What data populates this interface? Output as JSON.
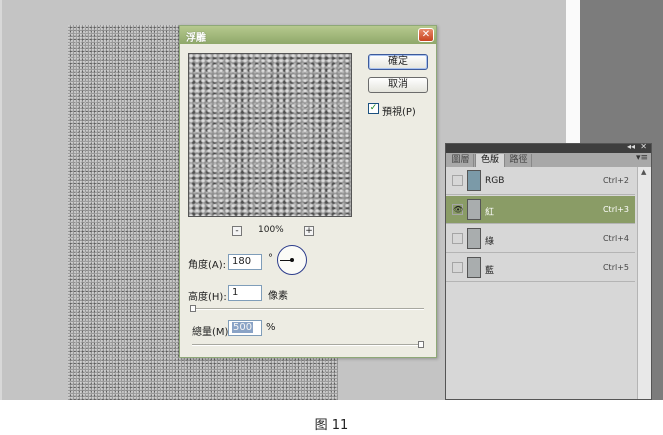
{
  "dialog": {
    "title": "浮雕",
    "close": "✕",
    "zoom_out": "-",
    "zoom_in": "+",
    "zoom_level": "100%",
    "ok_label": "確定",
    "cancel_label": "取消",
    "preview_label": "預視(P)",
    "preview_checked": "✓",
    "angle_label": "角度(A):",
    "angle_value": "180",
    "angle_unit": "°",
    "height_label": "高度(H):",
    "height_value": "1",
    "height_unit": "像素",
    "amount_label": "總量(M)",
    "amount_value": "500",
    "amount_unit": "%"
  },
  "channels_panel": {
    "collapse_icon": "◂◂",
    "close_icon": "✕",
    "menu_icon": "▾≡",
    "tabs": [
      "圖層",
      "色版",
      "路徑"
    ],
    "rows": [
      {
        "name": "RGB",
        "shortcut": "Ctrl+2",
        "eye": ""
      },
      {
        "name": "紅",
        "shortcut": "Ctrl+3",
        "eye": "👁"
      },
      {
        "name": "綠",
        "shortcut": "Ctrl+4",
        "eye": ""
      },
      {
        "name": "藍",
        "shortcut": "Ctrl+5",
        "eye": ""
      }
    ],
    "scroll_up": "▲"
  },
  "caption": "图 11",
  "colors": {
    "title_bar": "#8fa86a",
    "selected_row": "#8a9c66",
    "close_button": "#c8431f"
  }
}
